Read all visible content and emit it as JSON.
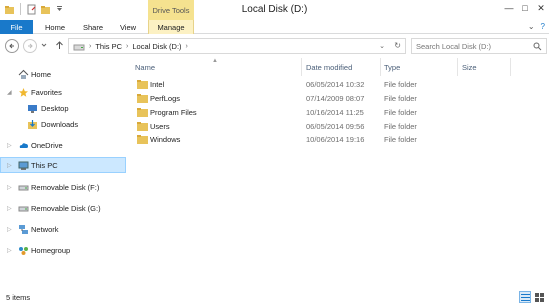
{
  "window": {
    "title": "Local Disk (D:)",
    "context_tab": "Drive Tools",
    "controls": [
      "—",
      "□",
      "✕"
    ]
  },
  "quick_access": {
    "icons": [
      "properties-icon",
      "new-folder-icon",
      "customize-dropdown-icon"
    ]
  },
  "ribbon": {
    "tabs": [
      {
        "label": "File"
      },
      {
        "label": "Home"
      },
      {
        "label": "Share"
      },
      {
        "label": "View"
      },
      {
        "label": "Manage"
      }
    ],
    "expand": "⌄",
    "help": "?"
  },
  "address": {
    "path": [
      "This PC",
      "Local Disk (D:)"
    ],
    "search_placeholder": "Search Local Disk (D:)"
  },
  "nav": {
    "items": [
      {
        "label": "Home",
        "icon": "home-icon"
      },
      {
        "label": "Favorites",
        "icon": "star-icon"
      },
      {
        "label": "Desktop",
        "icon": "desktop-icon"
      },
      {
        "label": "Downloads",
        "icon": "downloads-icon"
      },
      {
        "label": "OneDrive",
        "icon": "onedrive-icon"
      },
      {
        "label": "This PC",
        "icon": "computer-icon"
      },
      {
        "label": "Removable Disk (F:)",
        "icon": "usb-drive-icon"
      },
      {
        "label": "Removable Disk (G:)",
        "icon": "usb-drive-icon"
      },
      {
        "label": "Network",
        "icon": "network-icon"
      },
      {
        "label": "Homegroup",
        "icon": "homegroup-icon"
      }
    ]
  },
  "files": {
    "columns": {
      "name": "Name",
      "date": "Date modified",
      "type": "Type",
      "size": "Size"
    },
    "rows": [
      {
        "name": "Intel",
        "date": "06/05/2014 10:32",
        "type": "File folder"
      },
      {
        "name": "PerfLogs",
        "date": "07/14/2009 08:07",
        "type": "File folder"
      },
      {
        "name": "Program Files",
        "date": "10/16/2014 11:25",
        "type": "File folder"
      },
      {
        "name": "Users",
        "date": "06/05/2014 09:56",
        "type": "File folder"
      },
      {
        "name": "Windows",
        "date": "10/06/2014 19:16",
        "type": "File folder"
      }
    ]
  },
  "status": {
    "item_count": "5 items"
  },
  "colors": {
    "accent": "#1979ca",
    "folder": "#e8c35a",
    "selection": "#cce8ff",
    "manage_tab": "#fcf1c3",
    "drive_tools": "#f5e28f"
  }
}
